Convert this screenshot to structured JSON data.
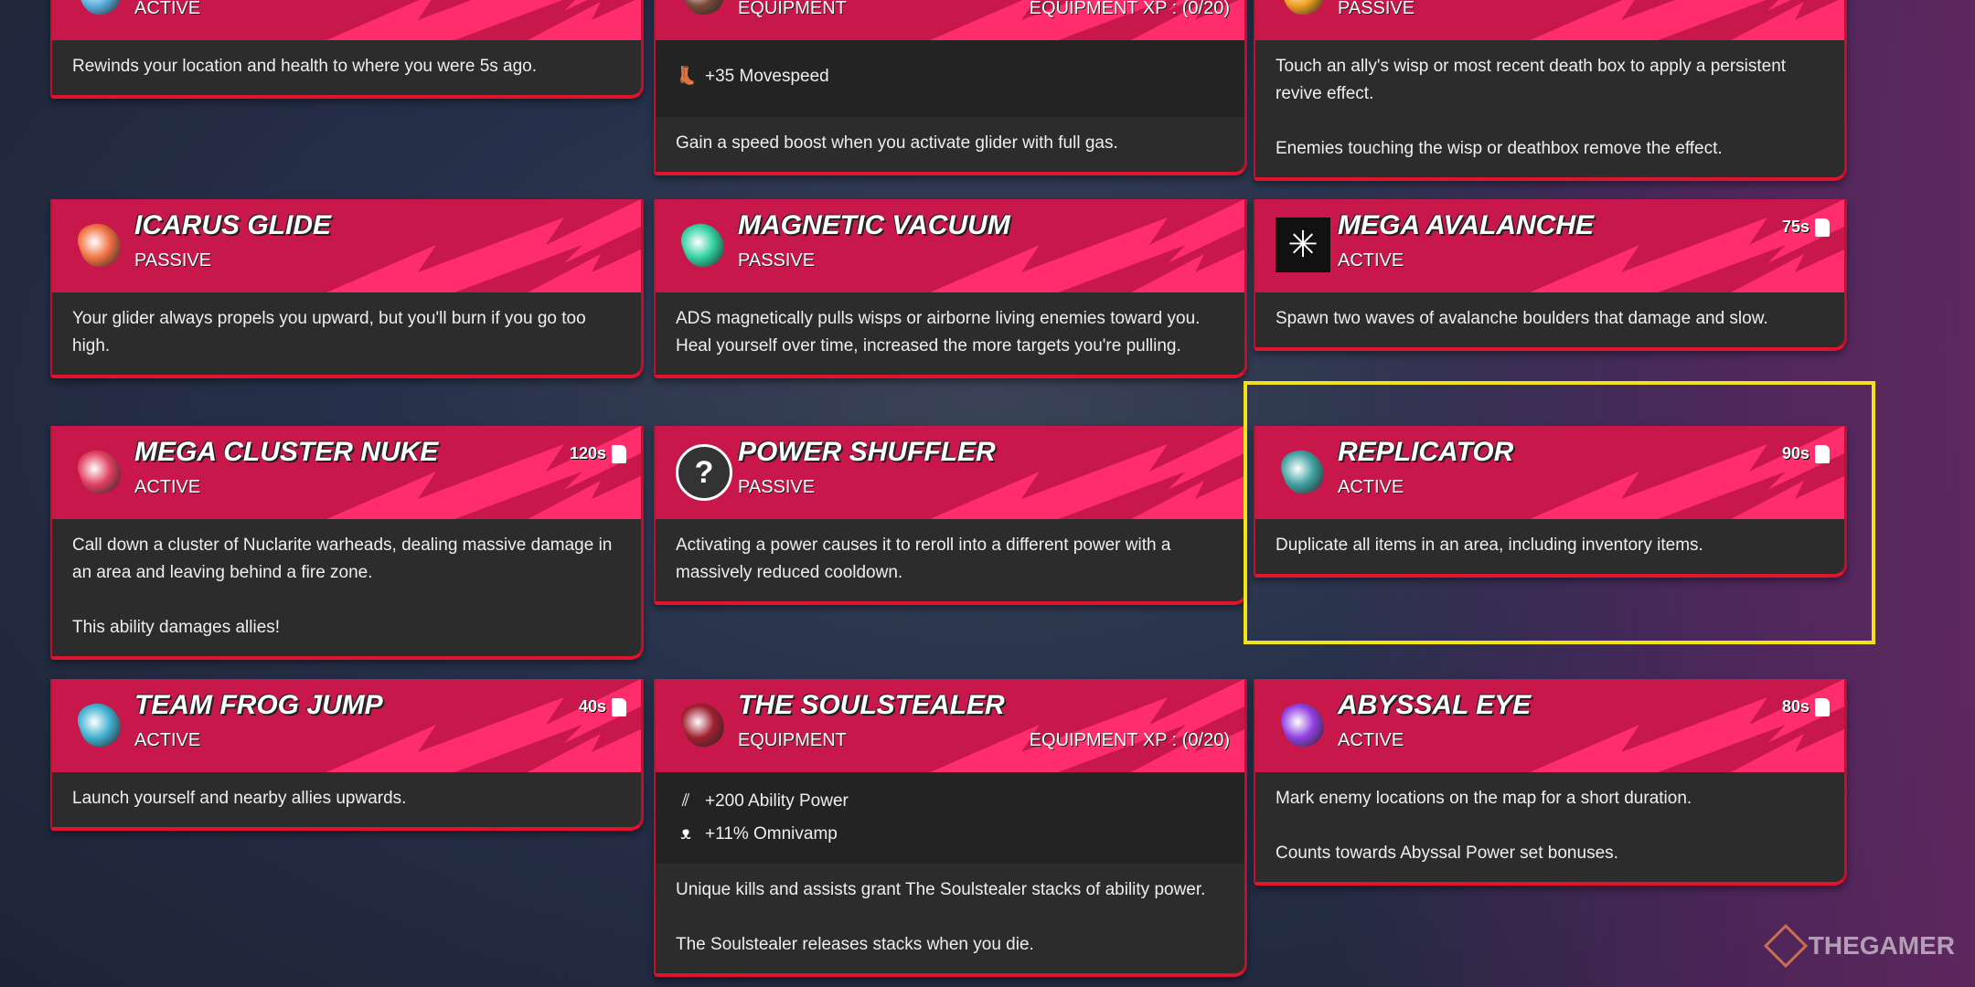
{
  "cards": [
    {
      "type": "ACTIVE",
      "icon": "rewind-icon",
      "icon_color": "#5ab0e0",
      "desc": [
        "Rewinds your location and health to where you were 5s ago."
      ]
    },
    {
      "type": "EQUIPMENT",
      "xp": "EQUIPMENT XP : (0/20)",
      "icon": "glider-equipment-icon",
      "icon_color": "#7a4a3a",
      "stats": [
        {
          "icon": "boot-icon",
          "text": "+35 Movespeed"
        }
      ],
      "desc": [
        "Gain a speed boost when you activate glider with full gas."
      ]
    },
    {
      "type": "PASSIVE",
      "icon": "revive-flame-icon",
      "icon_color": "#f0a020",
      "desc": [
        "Touch an ally's wisp or most recent death box to apply a persistent revive effect.",
        "Enemies touching the wisp or deathbox remove the effect."
      ]
    },
    {
      "title": "ICARUS GLIDE",
      "type": "PASSIVE",
      "icon": "flame-wing-icon",
      "icon_color": "#f07040",
      "desc": [
        "Your glider always propels you upward, but you'll burn if you go too high."
      ]
    },
    {
      "title": "MAGNETIC VACUUM",
      "type": "PASSIVE",
      "icon": "magnet-claw-icon",
      "icon_color": "#30d0a0",
      "desc": [
        "ADS magnetically pulls wisps or airborne living enemies toward you. Heal yourself over time, increased the more targets you're pulling."
      ]
    },
    {
      "title": "MEGA AVALANCHE",
      "type": "ACTIVE",
      "cooldown": "75s",
      "icon": "snowflake-icon",
      "icon_color": "#ffffff",
      "desc": [
        "Spawn two waves of avalanche boulders that damage and slow."
      ]
    },
    {
      "title": "MEGA CLUSTER NUKE",
      "type": "ACTIVE",
      "cooldown": "120s",
      "icon": "missile-icon",
      "icon_color": "#e04060",
      "desc": [
        "Call down a cluster of Nuclarite warheads, dealing massive damage in an area and leaving behind a fire zone.",
        "This ability damages allies!"
      ]
    },
    {
      "title": "POWER SHUFFLER",
      "type": "PASSIVE",
      "icon": "question-mark-icon",
      "icon_color": "#333333",
      "desc": [
        "Activating a power causes it to reroll into a different power with a massively reduced cooldown."
      ]
    },
    {
      "title": "REPLICATOR",
      "type": "ACTIVE",
      "cooldown": "90s",
      "icon": "replicator-orb-icon",
      "icon_color": "#40a0a0",
      "desc": [
        "Duplicate all items in an area, including inventory items."
      ]
    },
    {
      "title": "TEAM FROG JUMP",
      "type": "ACTIVE",
      "cooldown": "40s",
      "icon": "frog-boot-icon",
      "icon_color": "#40b0d0",
      "desc": [
        "Launch yourself and nearby allies upwards."
      ]
    },
    {
      "title": "THE SOULSTEALER",
      "type": "EQUIPMENT",
      "xp": "EQUIPMENT XP : (0/20)",
      "icon": "soulstealer-figure-icon",
      "icon_color": "#a02030",
      "stats": [
        {
          "icon": "claw-slash-icon",
          "text": "+200 Ability Power"
        },
        {
          "icon": "bat-icon",
          "text": "+11% Omnivamp"
        }
      ],
      "desc": [
        "Unique kills and assists grant The Soulstealer stacks of ability power.",
        "The Soulstealer releases stacks when you die."
      ]
    },
    {
      "title": "ABYSSAL EYE",
      "type": "ACTIVE",
      "cooldown": "80s",
      "icon": "abyssal-eye-icon",
      "icon_color": "#9040e0",
      "desc": [
        "Mark enemy locations on the map for a short duration.",
        "Counts towards Abyssal Power set bonuses."
      ]
    }
  ],
  "watermark": "THEGAMER",
  "colors": {
    "header": "#c8184b",
    "stripe": "#ff2d6b",
    "body": "#2c2c2c",
    "border": "#e0142c",
    "highlight": "#f2e21a"
  }
}
